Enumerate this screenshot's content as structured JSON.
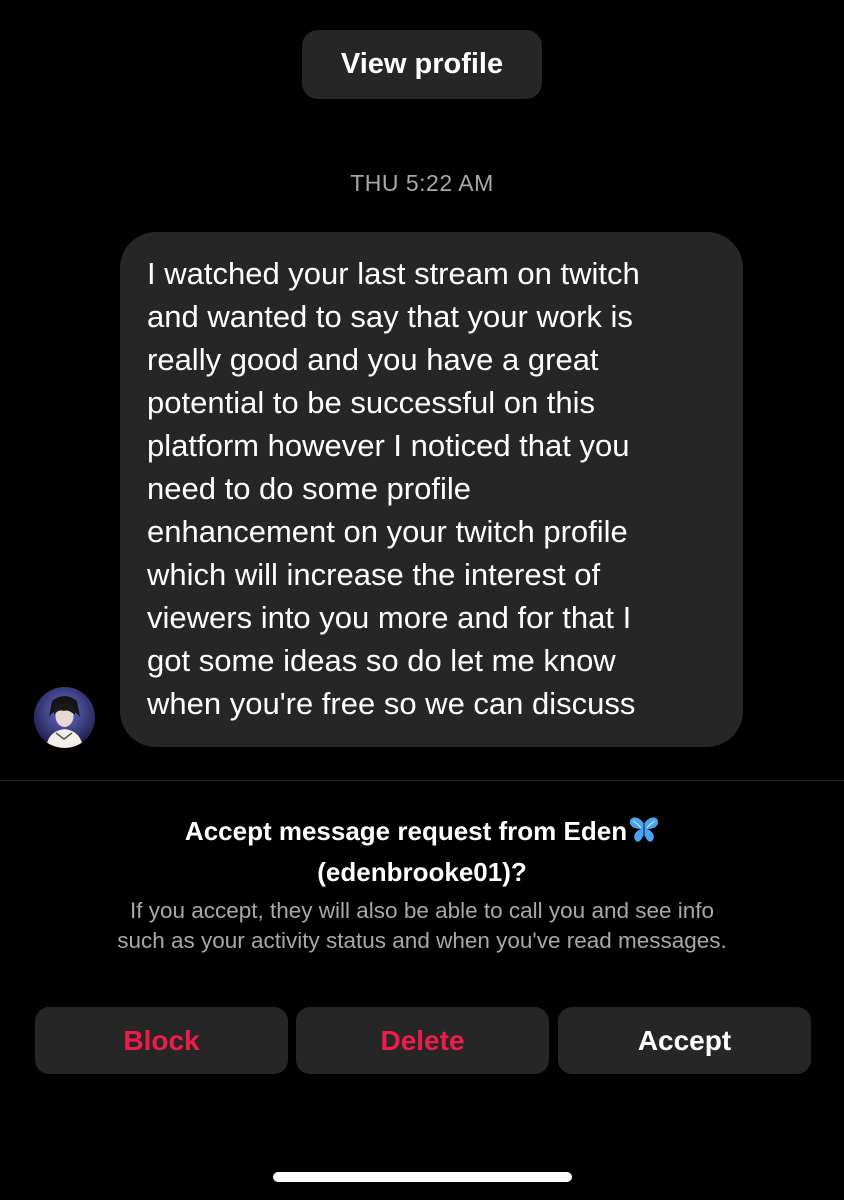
{
  "header": {
    "view_profile_label": "View profile"
  },
  "conversation": {
    "timestamp": "THU 5:22 AM",
    "messages": [
      {
        "sender": "Eden",
        "text": "I watched your last stream on twitch\nand wanted to say that your work is\nreally good and you have a great\npotential to be successful on this\nplatform however I noticed that you\nneed to do some profile\nenhancement on your twitch profile\nwhich will increase the interest of\nviewers into you more and for that I\ngot some ideas so do let me know\nwhen you're free so we can discuss"
      }
    ]
  },
  "request": {
    "title_line1": "Accept message request from Eden",
    "title_emoji": "butterfly-icon",
    "title_line2": "(edenbrooke01)?",
    "info_line1": "If you accept, they will also be able to call you and see info",
    "info_line2": "such as your activity status and when you've read messages."
  },
  "actions": {
    "block_label": "Block",
    "delete_label": "Delete",
    "accept_label": "Accept"
  },
  "colors": {
    "background": "#000000",
    "surface": "#262626",
    "secondary_text": "#a8a8a8",
    "destructive": "#ed1c4a",
    "butterfly": "#4aa3f0"
  }
}
